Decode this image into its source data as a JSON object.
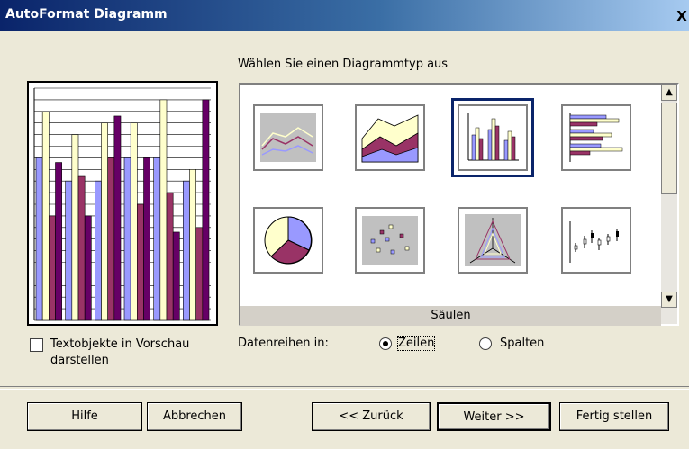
{
  "window": {
    "title": "AutoFormat Diagramm",
    "close": "X"
  },
  "chart_type": {
    "label": "Wählen Sie einen Diagrammtyp aus",
    "selected_caption": "Säulen",
    "types": [
      "line",
      "area",
      "column",
      "bar",
      "pie",
      "xy-scatter",
      "net",
      "stock"
    ]
  },
  "preview": {
    "chart_data": {
      "type": "bar",
      "series_colors": [
        "#9999ff",
        "#ffffcc",
        "#993366",
        "#660066"
      ],
      "series": [
        {
          "values": [
            7,
            6,
            6,
            7,
            7,
            6
          ]
        },
        {
          "values": [
            9,
            8,
            8.5,
            8.5,
            9.5,
            6.5
          ]
        },
        {
          "values": [
            4.5,
            6.2,
            7,
            5,
            5.5,
            4
          ]
        },
        {
          "values": [
            6.8,
            4.5,
            8.8,
            7,
            3.8,
            9.5
          ]
        }
      ]
    }
  },
  "options": {
    "text_preview_line1": "Textobjekte in Vorschau",
    "text_preview_line2": "darstellen",
    "data_series_label": "Datenreihen in:",
    "rows": "Zeilen",
    "columns": "Spalten"
  },
  "buttons": {
    "help": "Hilfe",
    "cancel": "Abbrechen",
    "back": "<< Zurück",
    "next": "Weiter >>",
    "finish": "Fertig stellen"
  }
}
